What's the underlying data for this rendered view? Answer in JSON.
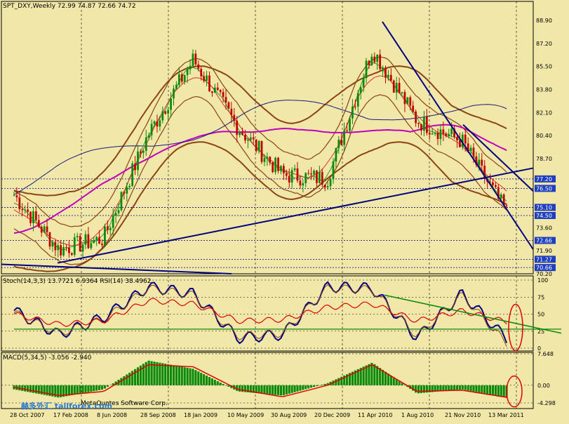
{
  "main": {
    "title": "SPT_DXY,Weekly  72.99 74.87 72.66 74.72",
    "price_ticks": [
      "88.90",
      "87.20",
      "85.50",
      "83.80",
      "82.10",
      "80.40",
      "78.70",
      "77.20",
      "76.50",
      "75.10",
      "74.50",
      "73.60",
      "72.66",
      "71.90",
      "71.27",
      "70.66",
      "70.20"
    ],
    "highlight_ticks": [
      "77.20",
      "76.50",
      "75.10",
      "74.50",
      "72.66",
      "71.27",
      "70.66"
    ],
    "ylim": [
      70.2,
      90.3
    ]
  },
  "stoch": {
    "title": "Stoch(14,3,3) 13.7721 6.9364  RSI(14) 38.4962",
    "ticks": [
      "100",
      "75",
      "50",
      "25",
      "0"
    ]
  },
  "macd": {
    "title": "MACD(5,34,5) -3.056 -2.940",
    "ticks": [
      "7.648",
      "0.00",
      "-4.298"
    ]
  },
  "watermark": "赫多外汇 tallforex.com",
  "mq_label": "MetaQuotes Software Corp.",
  "x_labels": [
    "28 Oct 2007",
    "17 Feb 2008",
    "8 Jun 2008",
    "28 Sep 2008",
    "18 Jan 2009",
    "10 May 2009",
    "30 Aug 2009",
    "20 Dec 2009",
    "11 Apr 2010",
    "1 Aug 2010",
    "21 Nov 2010",
    "13 Mar 2011"
  ],
  "colors": {
    "background": "#f0e7a8",
    "bull": "#0a8a0a",
    "bear": "#c00000",
    "trendline": "#000080",
    "bollinger": "#8b4513",
    "ma_magenta": "#c000c0",
    "ma_navy": "#1a1a80",
    "stoch_main": "#000080",
    "rsi": "#e00000",
    "macd_hist": "#0a8a0a",
    "macd_signal": "#e00000",
    "highlight_box": "#1f3fbf",
    "circle": "#e00000"
  },
  "chart_data": [
    {
      "type": "candlestick",
      "title": "SPT_DXY,Weekly",
      "x": [
        "28 Oct 2007",
        "17 Feb 2008",
        "8 Jun 2008",
        "28 Sep 2008",
        "18 Jan 2009",
        "10 May 2009",
        "30 Aug 2009",
        "20 Dec 2009",
        "11 Apr 2010",
        "1 Aug 2010",
        "21 Nov 2010",
        "13 Mar 2011"
      ],
      "close_approx": [
        76.0,
        72.0,
        72.8,
        80.5,
        86.0,
        81.0,
        77.5,
        77.2,
        86.8,
        81.5,
        80.0,
        74.72
      ],
      "last": {
        "open": 72.99,
        "high": 74.87,
        "low": 72.66,
        "close": 74.72
      },
      "ylim": [
        70.2,
        90.3
      ]
    },
    {
      "type": "line",
      "title": "Stoch(14,3,3) / RSI(14)",
      "series": [
        {
          "name": "Stoch main",
          "values": [
            55,
            20,
            45,
            90,
            80,
            15,
            20,
            90,
            88,
            15,
            80,
            13.7721
          ]
        },
        {
          "name": "Stoch signal",
          "values": [
            52,
            22,
            42,
            88,
            78,
            18,
            22,
            88,
            86,
            18,
            78,
            6.9364
          ]
        },
        {
          "name": "RSI",
          "values": [
            50,
            35,
            40,
            70,
            65,
            40,
            42,
            60,
            65,
            40,
            55,
            38.4962
          ]
        }
      ],
      "ylim": [
        0,
        100
      ]
    },
    {
      "type": "bar",
      "title": "MACD(5,34,5)",
      "series": [
        {
          "name": "MACD",
          "values": [
            -1.0,
            -3.0,
            -1.0,
            6.0,
            4.0,
            -1.5,
            -2.5,
            0.5,
            5.5,
            -2.0,
            -1.0,
            -3.056
          ]
        },
        {
          "name": "Signal",
          "values": [
            -0.5,
            -2.5,
            -1.5,
            5.0,
            4.5,
            -1.0,
            -2.8,
            0.0,
            5.0,
            -1.5,
            -1.2,
            -2.94
          ]
        }
      ],
      "ylim": [
        -4.298,
        7.648
      ]
    }
  ]
}
